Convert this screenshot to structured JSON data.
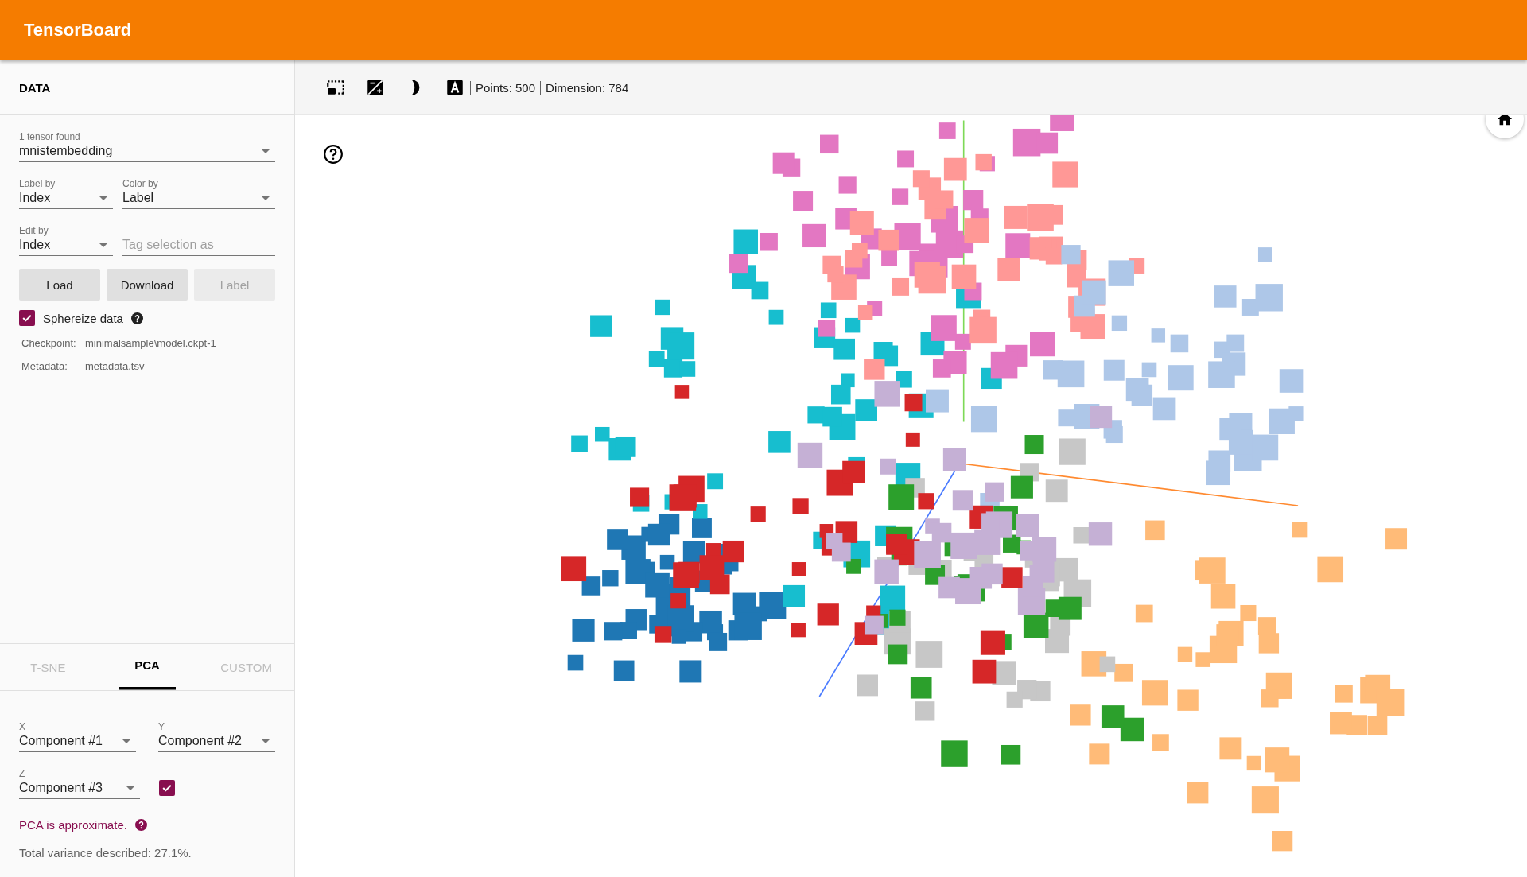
{
  "header": {
    "title": "TensorBoard"
  },
  "data_panel": {
    "title": "DATA",
    "tensor_select": {
      "label": "1 tensor found",
      "value": "mnistembedding"
    },
    "label_by": {
      "label": "Label by",
      "value": "Index"
    },
    "color_by": {
      "label": "Color by",
      "value": "Label"
    },
    "edit_by": {
      "label": "Edit by",
      "value": "Index"
    },
    "tag_field": {
      "placeholder": "Tag selection as"
    },
    "buttons": [
      {
        "label": "Load",
        "disabled": false
      },
      {
        "label": "Download",
        "disabled": false
      },
      {
        "label": "Label",
        "disabled": true
      }
    ],
    "sphereize": {
      "label": "Sphereize data",
      "checked": true
    },
    "info": [
      {
        "key": "Checkpoint:",
        "value": "minimalsample\\model.ckpt-1"
      },
      {
        "key": "Metadata:",
        "value": "metadata.tsv"
      }
    ]
  },
  "projection_tabs": [
    {
      "label": "T-SNE",
      "selected": false
    },
    {
      "label": "PCA",
      "selected": true
    },
    {
      "label": "CUSTOM",
      "selected": false
    }
  ],
  "pca": {
    "x": {
      "label": "X",
      "value": "Component #1"
    },
    "y": {
      "label": "Y",
      "value": "Component #2"
    },
    "z": {
      "label": "Z",
      "value": "Component #3"
    },
    "z_enabled": {
      "checked": true
    },
    "note": "PCA is approximate.",
    "variance": "Total variance described: 27.1%."
  },
  "toolbar": {
    "points": "Points: 500",
    "dimension": "Dimension: 784"
  }
}
